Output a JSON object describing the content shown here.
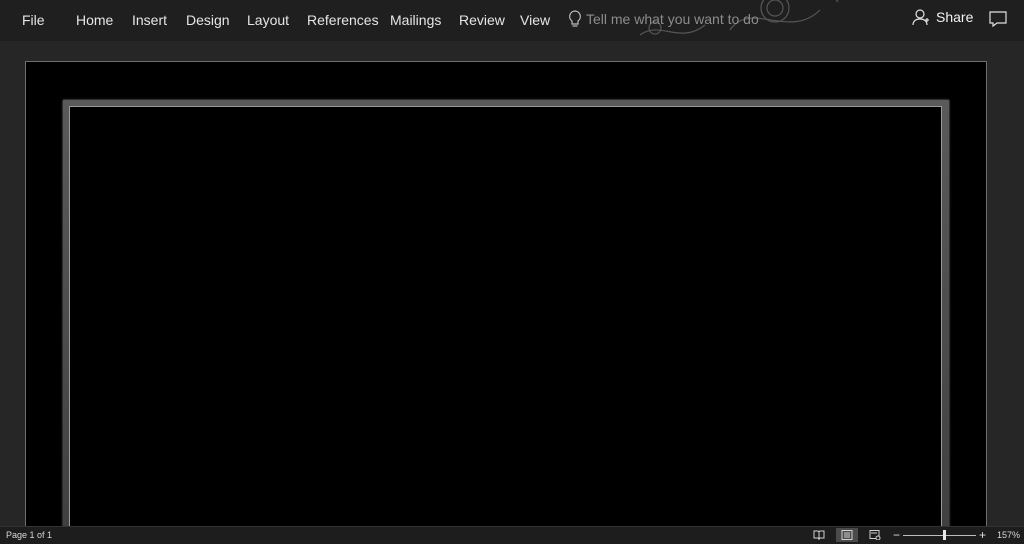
{
  "ribbon": {
    "tabs": [
      {
        "label": "File"
      },
      {
        "label": "Home"
      },
      {
        "label": "Insert"
      },
      {
        "label": "Design"
      },
      {
        "label": "Layout"
      },
      {
        "label": "References"
      },
      {
        "label": "Mailings"
      },
      {
        "label": "Review"
      },
      {
        "label": "View"
      }
    ],
    "tell_me_placeholder": "Tell me what you want to do",
    "share_label": "Share",
    "icons": {
      "tell_me": "lightbulb-icon",
      "share": "person-add-icon",
      "comments": "comment-icon"
    }
  },
  "status": {
    "page_count": "Page 1 of 1",
    "zoom_level": "157%",
    "zoom_minus": "−",
    "zoom_plus": "+",
    "view_icons": [
      "read-mode-icon",
      "print-layout-icon",
      "web-layout-icon"
    ],
    "active_view": "print-layout"
  },
  "colors": {
    "ribbon_bg": "#1f1f1f",
    "canvas_bg": "#262626",
    "page_bg": "#000000",
    "border_frame": "#9a9a9a"
  }
}
